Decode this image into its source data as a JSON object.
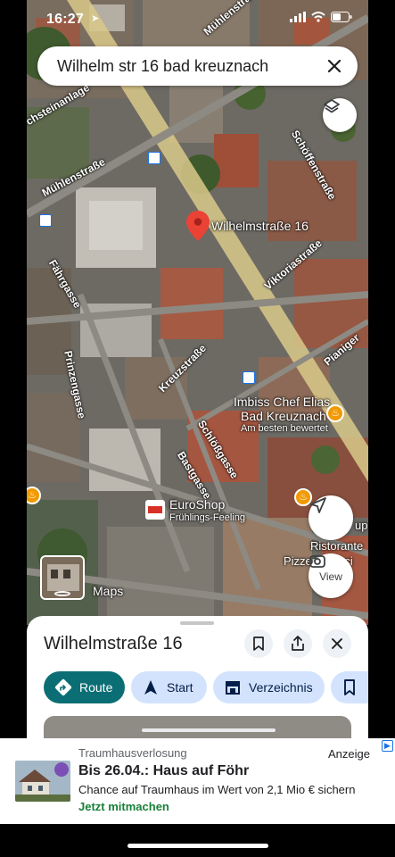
{
  "status": {
    "time": "16:27"
  },
  "search": {
    "query": "Wilhelm str 16 bad kreuznach"
  },
  "map": {
    "pin_label": "Wilhelmstraße 16",
    "streets": {
      "sechsteinanlage": "chsteinanlage",
      "muehlenstrasse_top": "Mühlenstraße",
      "muehlenstrasse_left": "Mühlenstraße",
      "schoeffenstrasse": "Schöffenstraße",
      "viktoriastrasse": "Viktoriastraße",
      "faehrgasse": "Fährgasse",
      "prinzengasse": "Prinzengasse",
      "kreuzstrasse": "Kreuzstraße",
      "schloegasse": "Schlößgasse",
      "bastgasse": "Bastgasse",
      "pianiger": "Pianiger"
    },
    "pois": {
      "imbiss_name_1": "Imbiss Chef Elias",
      "imbiss_name_2": "Bad Kreuznach",
      "imbiss_sub": "Am besten bewertet",
      "euroshop_name": "EuroShop",
      "euroshop_sub": "Frühlings-Feeling",
      "ristorante": "Ristorante",
      "pizzeria": "Pizzeria Vinci",
      "cup": "up"
    },
    "view_label": "View",
    "maps_logo": "Maps"
  },
  "sheet": {
    "title": "Wilhelmstraße 16",
    "chips": {
      "route": "Route",
      "start": "Start",
      "directory": "Verzeichnis"
    }
  },
  "ad": {
    "source": "Traumhausverlosung",
    "badge": "Anzeige",
    "title": "Bis 26.04.: Haus auf Föhr",
    "description": "Chance auf Traumhaus im Wert von 2,1 Mio € sichern",
    "cta": "Jetzt mitmachen"
  },
  "colors": {
    "accent": "#0b57d0",
    "route_chip": "#0b6e74",
    "pin": "#ea4335",
    "ad_cta": "#188038"
  }
}
